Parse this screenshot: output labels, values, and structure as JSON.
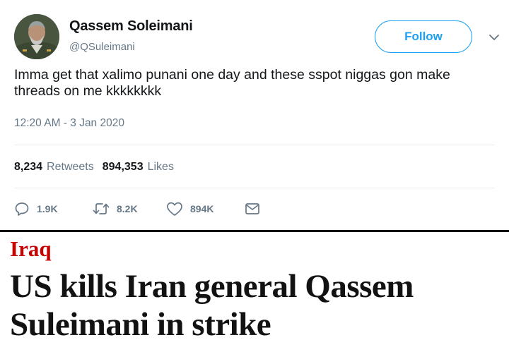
{
  "tweet": {
    "author_name": "Qassem Soleimani",
    "author_handle": "@QSuleimani",
    "follow_label": "Follow",
    "text": "Imma get that xalimo punani one day and these sspot niggas gon make threads on me kkkkkkkk",
    "timestamp": "12:20 AM - 3 Jan 2020",
    "retweets_count": "8,234",
    "retweets_label": "Retweets",
    "likes_count": "894,353",
    "likes_label": "Likes",
    "actions": {
      "reply_count": "1.9K",
      "retweet_count": "8.2K",
      "like_count": "894K"
    },
    "icons": [
      "avatar",
      "chevron-down-icon",
      "reply-icon",
      "retweet-icon",
      "like-icon",
      "message-icon"
    ],
    "colors": {
      "accent": "#1da1f2",
      "secondary_text": "#657786",
      "divider": "#e6ecf0"
    }
  },
  "news": {
    "section": "Iraq",
    "headline": "US kills Iran general Qassem Suleimani in strike",
    "colors": {
      "section": "#c70000",
      "headline": "#121212"
    }
  }
}
